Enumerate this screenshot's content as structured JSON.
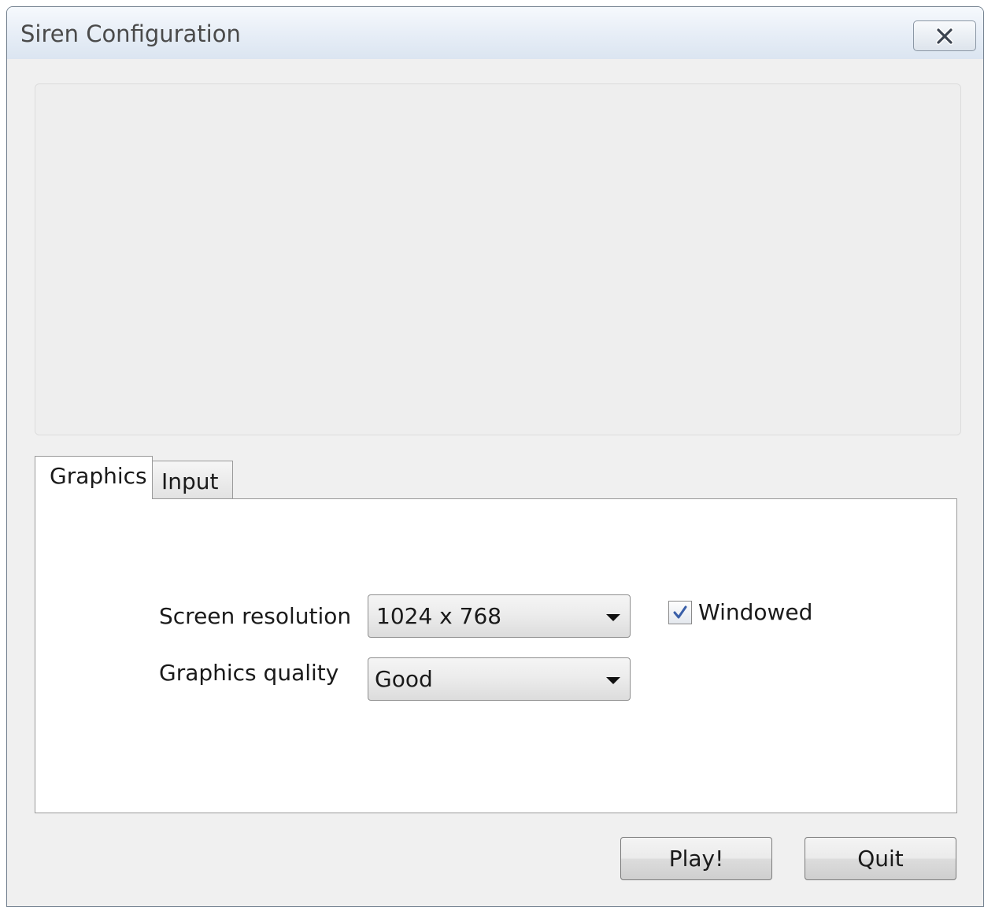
{
  "window": {
    "title": "Siren Configuration"
  },
  "tabs": [
    {
      "label": "Graphics",
      "active": true
    },
    {
      "label": "Input",
      "active": false
    }
  ],
  "graphics": {
    "resolution": {
      "label": "Screen resolution",
      "value": "1024 x 768"
    },
    "quality": {
      "label": "Graphics quality",
      "value": "Good"
    },
    "windowed": {
      "label": "Windowed",
      "checked": true
    }
  },
  "buttons": {
    "play": "Play!",
    "quit": "Quit"
  },
  "icons": {
    "close": "close-icon",
    "dropdown": "chevron-down-icon",
    "check": "check-icon"
  },
  "colors": {
    "titlebar_top": "#f6f9fd",
    "titlebar_bottom": "#dbe5f1",
    "client_bg": "#f0f0f0",
    "check": "#3a5fa8"
  }
}
